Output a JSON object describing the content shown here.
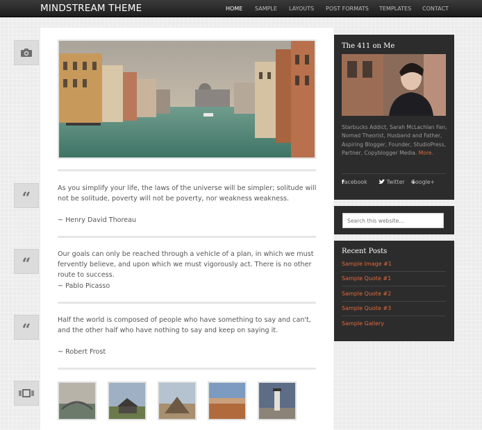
{
  "header": {
    "logo": "MINDSTREAM THEME",
    "nav": [
      {
        "label": "HOME",
        "active": true
      },
      {
        "label": "SAMPLE",
        "active": false
      },
      {
        "label": "LAYOUTS",
        "active": false
      },
      {
        "label": "POST FORMATS",
        "active": false
      },
      {
        "label": "TEMPLATES",
        "active": false
      },
      {
        "label": "CONTACT",
        "active": false
      }
    ]
  },
  "format_icons": [
    "camera-icon",
    "quote-icon",
    "quote-icon",
    "quote-icon",
    "gallery-icon"
  ],
  "posts": [
    {
      "quote": "As you simplify your life, the laws of the universe will be simpler; solitude will not be solitude, poverty will not be poverty, nor weakness weakness.",
      "author": "~ Henry David Thoreau"
    },
    {
      "quote": "Our goals can only be reached through a vehicle of a plan, in which we must fervently believe, and upon which we must vigorously act. There is no other route to success.",
      "author": "~ Pablo Picasso"
    },
    {
      "quote": "Half the world is composed of people who have something to say and can't, and the other half who have nothing to say and keep on saying it.",
      "author": "~ Robert Frost"
    }
  ],
  "sidebar": {
    "about": {
      "title": "The 411 on Me",
      "text": "Starbucks Addict, Sarah McLachlan Fan, Nomad Theorist, Husband and Father, Aspiring Blogger, Founder, StudioPress, Partner, Copyblogger Media.",
      "more": "More."
    },
    "social": [
      {
        "icon": "f",
        "label": "Facebook"
      },
      {
        "icon": "twitter-bird",
        "label": "Twitter"
      },
      {
        "icon": "+",
        "label": "Google+"
      }
    ],
    "search": {
      "placeholder": "Search this website…"
    },
    "recent": {
      "title": "Recent Posts",
      "items": [
        "Sample Image #1",
        "Sample Quote #1",
        "Sample Quote #2",
        "Sample Quote #3",
        "Sample Gallery"
      ]
    }
  },
  "colors": {
    "accent": "#e06b3c",
    "topbar": "#222222",
    "widget_bg": "#2c2c2c"
  }
}
